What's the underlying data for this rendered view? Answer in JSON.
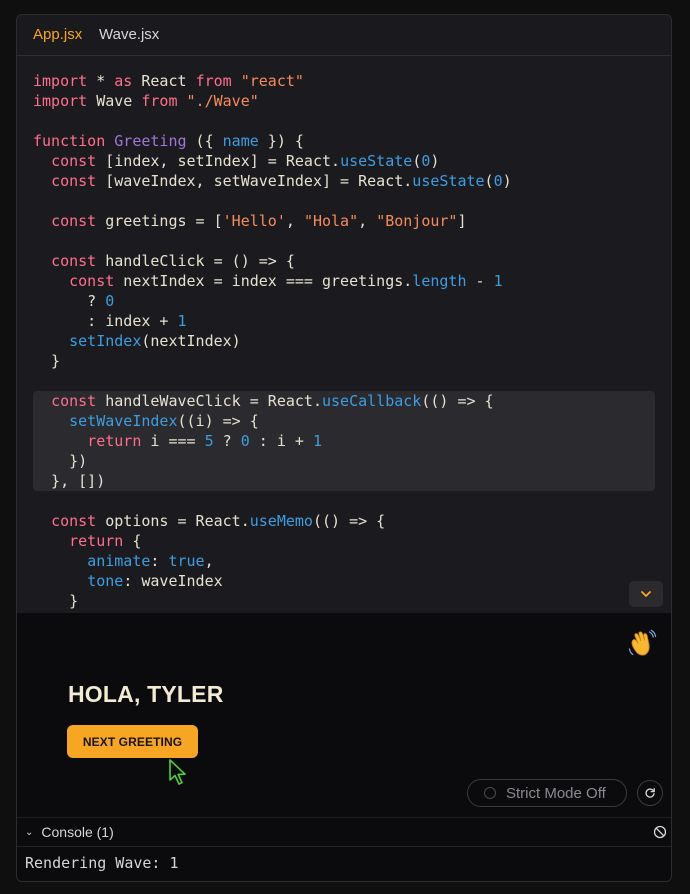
{
  "colors": {
    "accent": "#f6a623",
    "code_default": "#e6e1cf",
    "code_keyword": "#ff6e8b",
    "code_string": "#f68b5b",
    "code_function": "#a176d6",
    "code_property": "#3c9ee0",
    "code_number": "#3c9ee0",
    "ui_text": "#d6d6da",
    "ui_muted": "#8a8a90",
    "heading": "#f2ead3",
    "button_text": "#1a1204",
    "cursor_green": "#4cd137"
  },
  "tabs": [
    {
      "label": "App.jsx",
      "active": true
    },
    {
      "label": "Wave.jsx",
      "active": false
    }
  ],
  "editor": {
    "lines": [
      [
        [
          "import",
          "keyword"
        ],
        [
          " * ",
          "default"
        ],
        [
          "as",
          "keyword"
        ],
        [
          " React ",
          "default"
        ],
        [
          "from",
          "keyword"
        ],
        [
          " ",
          "default"
        ],
        [
          "\"react\"",
          "string"
        ]
      ],
      [
        [
          "import",
          "keyword"
        ],
        [
          " Wave ",
          "default"
        ],
        [
          "from",
          "keyword"
        ],
        [
          " ",
          "default"
        ],
        [
          "\"./Wave\"",
          "string"
        ]
      ],
      [],
      [
        [
          "function",
          "keyword"
        ],
        [
          " ",
          "default"
        ],
        [
          "Greeting",
          "function"
        ],
        [
          " ({ ",
          "default"
        ],
        [
          "name",
          "property"
        ],
        [
          " }) {",
          "default"
        ]
      ],
      [
        [
          "  ",
          "default"
        ],
        [
          "const",
          "keyword"
        ],
        [
          " [index, setIndex] = React.",
          "default"
        ],
        [
          "useState",
          "property"
        ],
        [
          "(",
          "default"
        ],
        [
          "0",
          "number"
        ],
        [
          ")",
          "default"
        ]
      ],
      [
        [
          "  ",
          "default"
        ],
        [
          "const",
          "keyword"
        ],
        [
          " [waveIndex, setWaveIndex] = React.",
          "default"
        ],
        [
          "useState",
          "property"
        ],
        [
          "(",
          "default"
        ],
        [
          "0",
          "number"
        ],
        [
          ")",
          "default"
        ]
      ],
      [],
      [
        [
          "  ",
          "default"
        ],
        [
          "const",
          "keyword"
        ],
        [
          " greetings = [",
          "default"
        ],
        [
          "'Hello'",
          "string"
        ],
        [
          ", ",
          "default"
        ],
        [
          "\"Hola\"",
          "string"
        ],
        [
          ", ",
          "default"
        ],
        [
          "\"Bonjour\"",
          "string"
        ],
        [
          "]",
          "default"
        ]
      ],
      [],
      [
        [
          "  ",
          "default"
        ],
        [
          "const",
          "keyword"
        ],
        [
          " handleClick = () => {",
          "default"
        ]
      ],
      [
        [
          "    ",
          "default"
        ],
        [
          "const",
          "keyword"
        ],
        [
          " nextIndex = index === greetings.",
          "default"
        ],
        [
          "length",
          "property"
        ],
        [
          " - ",
          "default"
        ],
        [
          "1",
          "number"
        ]
      ],
      [
        [
          "      ? ",
          "default"
        ],
        [
          "0",
          "number"
        ]
      ],
      [
        [
          "      : index + ",
          "default"
        ],
        [
          "1",
          "number"
        ]
      ],
      [
        [
          "    ",
          "default"
        ],
        [
          "setIndex",
          "property"
        ],
        [
          "(nextIndex)",
          "default"
        ]
      ],
      [
        [
          "  }",
          "default"
        ]
      ],
      [],
      [
        [
          "  ",
          "default"
        ],
        [
          "const",
          "keyword"
        ],
        [
          " handleWaveClick = React.",
          "default"
        ],
        [
          "useCallback",
          "property"
        ],
        [
          "(() => {",
          "default"
        ]
      ],
      [
        [
          "    ",
          "default"
        ],
        [
          "setWaveIndex",
          "property"
        ],
        [
          "((i) => {",
          "default"
        ]
      ],
      [
        [
          "      ",
          "default"
        ],
        [
          "return",
          "keyword"
        ],
        [
          " i === ",
          "default"
        ],
        [
          "5",
          "number"
        ],
        [
          " ? ",
          "default"
        ],
        [
          "0",
          "number"
        ],
        [
          " : i + ",
          "default"
        ],
        [
          "1",
          "number"
        ]
      ],
      [
        [
          "    })",
          "default"
        ]
      ],
      [
        [
          "  }, [])",
          "default"
        ]
      ],
      [],
      [
        [
          "  ",
          "default"
        ],
        [
          "const",
          "keyword"
        ],
        [
          " options = React.",
          "default"
        ],
        [
          "useMemo",
          "property"
        ],
        [
          "(() => {",
          "default"
        ]
      ],
      [
        [
          "    ",
          "default"
        ],
        [
          "return",
          "keyword"
        ],
        [
          " {",
          "default"
        ]
      ],
      [
        [
          "      ",
          "default"
        ],
        [
          "animate",
          "property"
        ],
        [
          ": ",
          "default"
        ],
        [
          "true",
          "property"
        ],
        [
          ",",
          "default"
        ]
      ],
      [
        [
          "      ",
          "default"
        ],
        [
          "tone",
          "property"
        ],
        [
          ": waveIndex",
          "default"
        ]
      ],
      [
        [
          "    }",
          "default"
        ]
      ]
    ]
  },
  "preview": {
    "wave_emoji": "👋",
    "heading": "HOLA, TYLER",
    "button_label": "NEXT GREETING",
    "strict_mode_label": "Strict Mode Off"
  },
  "console": {
    "label": "Console (1)",
    "lines": [
      "Rendering Wave: 1"
    ]
  }
}
